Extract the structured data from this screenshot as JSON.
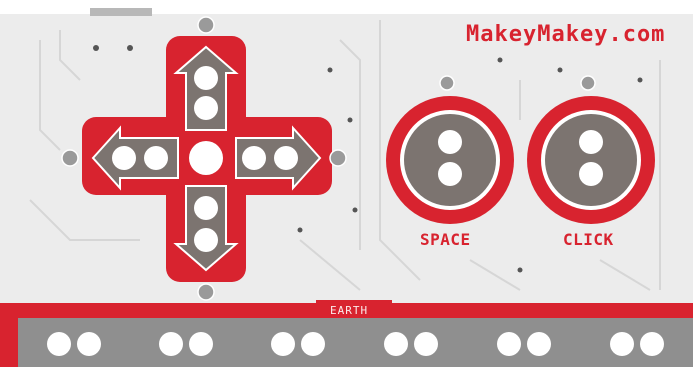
{
  "brand": {
    "text": "MakeyMakey.com"
  },
  "labels": {
    "space": "SPACE",
    "click": "CLICK",
    "earth": "EARTH"
  },
  "colors": {
    "board": "#ececec",
    "pcb_red": "#d8232f",
    "pad_metal": "#7c7470",
    "hole": "#ffffff",
    "earth_strip": "#8f8f8f"
  },
  "icons": [
    "arrow-up-icon",
    "arrow-down-icon",
    "arrow-left-icon",
    "arrow-right-icon"
  ]
}
